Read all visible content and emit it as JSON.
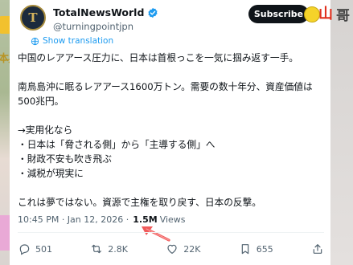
{
  "account": {
    "name": "TotalNewsWorld",
    "handle": "@turningpointjpn",
    "avatar_letter": "T"
  },
  "subscribe_label": "Subscribe",
  "translate_label": "Show translation",
  "tweet_lines": [
    "中国のレアアース圧力に、日本は首根っこを一気に掴み返す一手。",
    "",
    "南鳥島沖に眠るレアアース1600万トン。需要の数十年分、資産価値は500兆円。",
    "",
    "→実用化なら",
    "・日本は「脅される側」から「主導する側」へ",
    "・財政不安も吹き飛ぶ",
    "・減税が現実に",
    "",
    "これは夢ではない。資源で主権を取り戻す、日本の反撃。"
  ],
  "meta": {
    "time_date": "10:45 PM · Jan 12, 2026 ·",
    "views_count": "1.5M",
    "views_label": "Views"
  },
  "actions": {
    "replies": "501",
    "reposts": "2.8K",
    "likes": "22K",
    "bookmarks": "655"
  },
  "colors": {
    "accent": "#1d9bf0",
    "text": "#0f1419",
    "muted": "#536471",
    "annotation_arrow": "#f05a5a"
  }
}
